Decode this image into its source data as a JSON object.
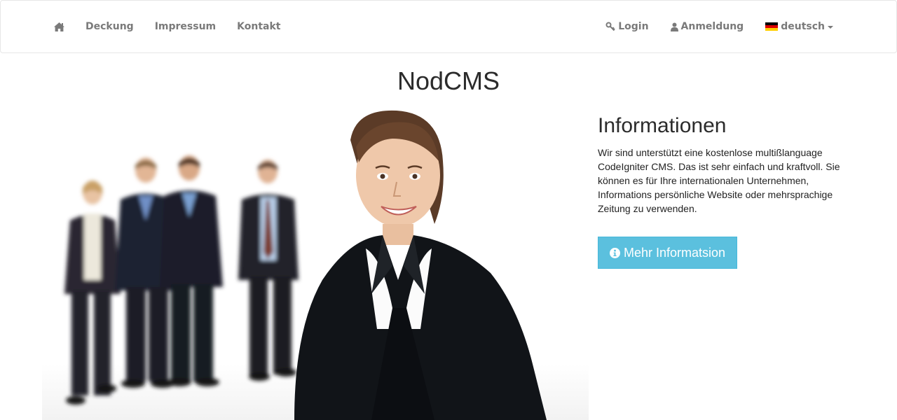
{
  "nav": {
    "home_icon": "home-icon",
    "links": [
      "Deckung",
      "Impressum",
      "Kontakt"
    ],
    "login_label": "Login",
    "login_icon": "key-icon",
    "register_label": "Anmeldung",
    "register_icon": "user-icon",
    "language_label": "deutsch",
    "language_flag": "german-flag-icon"
  },
  "hero": {
    "title": "NodCMS",
    "image": "business-team-photo"
  },
  "info": {
    "heading": "Informationen",
    "text": "Wir sind unterstützt eine kostenlose multißlanguage CodeIgniter CMS. Das ist sehr einfach und kraftvoll. Sie können es für Ihre internationalen Unternehmen, Informations persönliche Website oder mehrsprachige Zeitung zu verwenden.",
    "button_label": "Mehr Informatsion",
    "button_icon": "info-circle-icon"
  },
  "colors": {
    "button_bg": "#5bc0de",
    "nav_text": "#7a7a7a",
    "flag": [
      "#000000",
      "#dd0000",
      "#ffce00"
    ]
  }
}
